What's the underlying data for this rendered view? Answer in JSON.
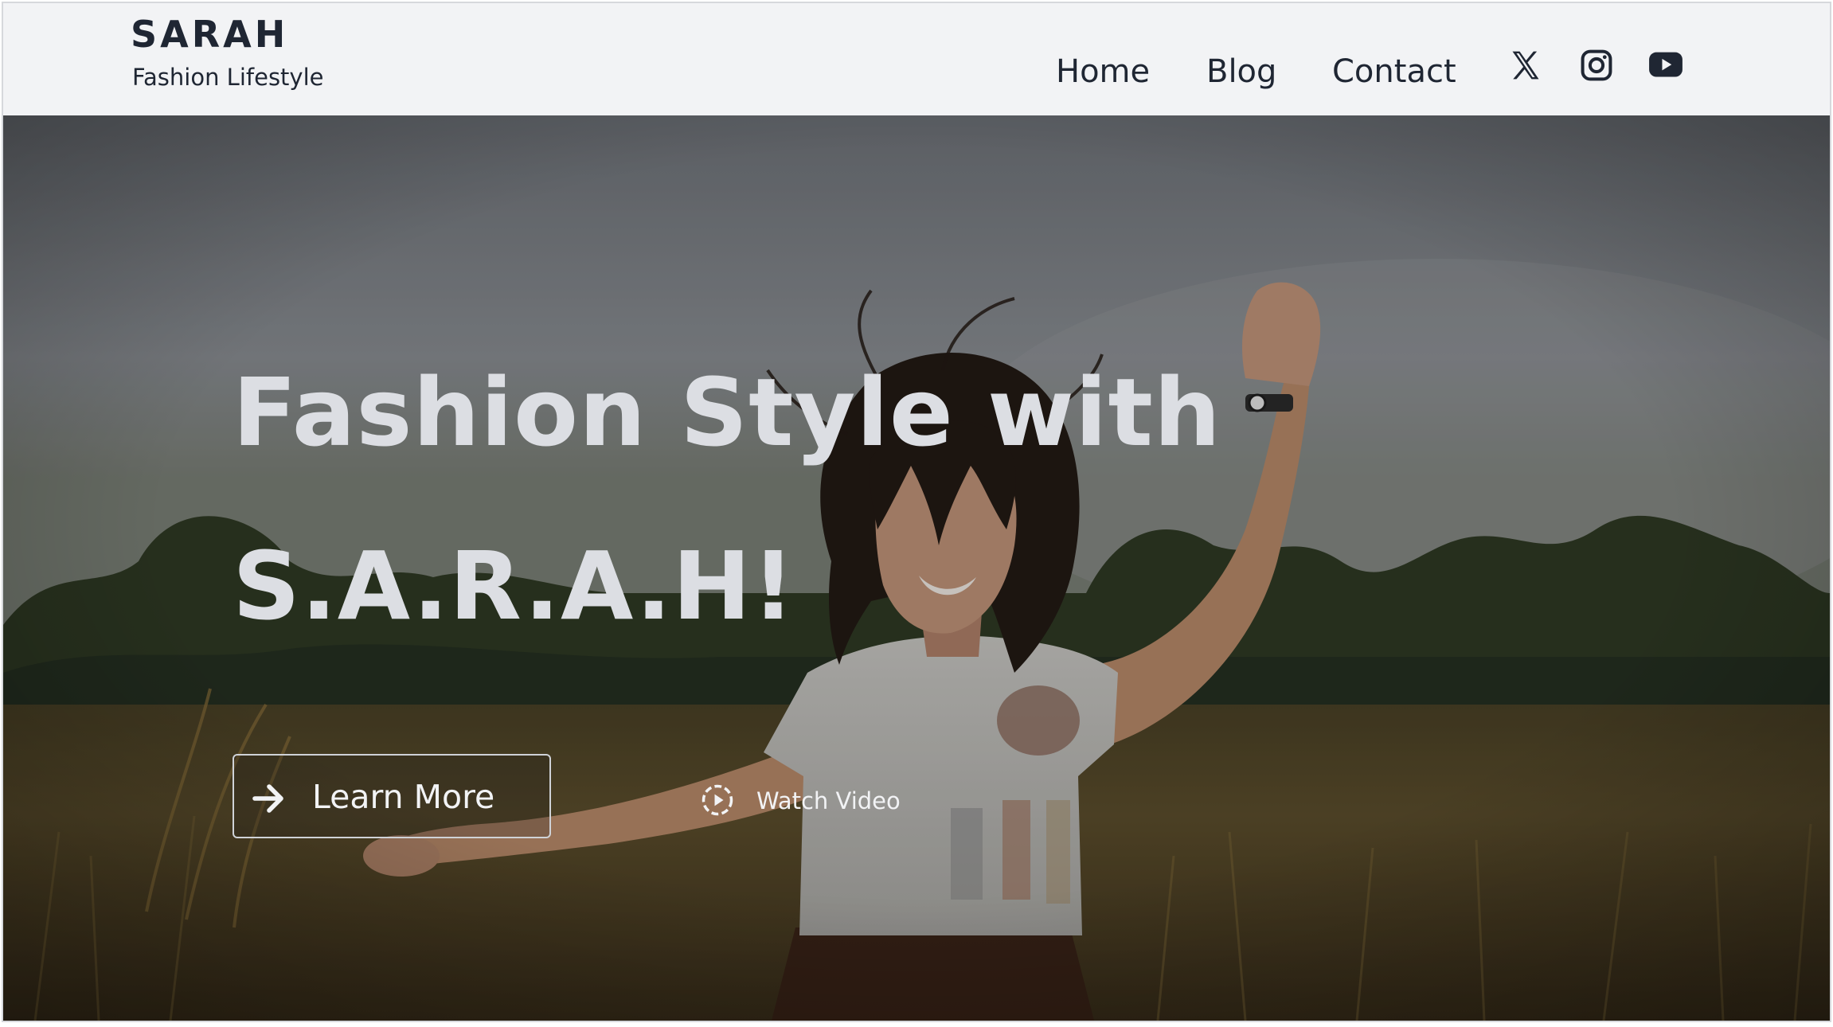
{
  "header": {
    "brand_title": "SARAH",
    "brand_tagline": "Fashion Lifestyle",
    "nav": [
      {
        "label": "Home"
      },
      {
        "label": "Blog"
      },
      {
        "label": "Contact"
      }
    ],
    "social_icons": [
      "x-icon",
      "instagram-icon",
      "youtube-icon"
    ]
  },
  "hero": {
    "heading_line1": "Fashion Style with",
    "heading_line2": "S.A.R.A.H!",
    "learn_more_label": "Learn More",
    "watch_video_label": "Watch Video",
    "background_image": "photo of a smiling woman in a white t-shirt dancing in a grassy field"
  },
  "colors": {
    "header_bg": "#f2f3f5",
    "text_dark": "#1f2633",
    "hero_text": "#dcdee3"
  }
}
